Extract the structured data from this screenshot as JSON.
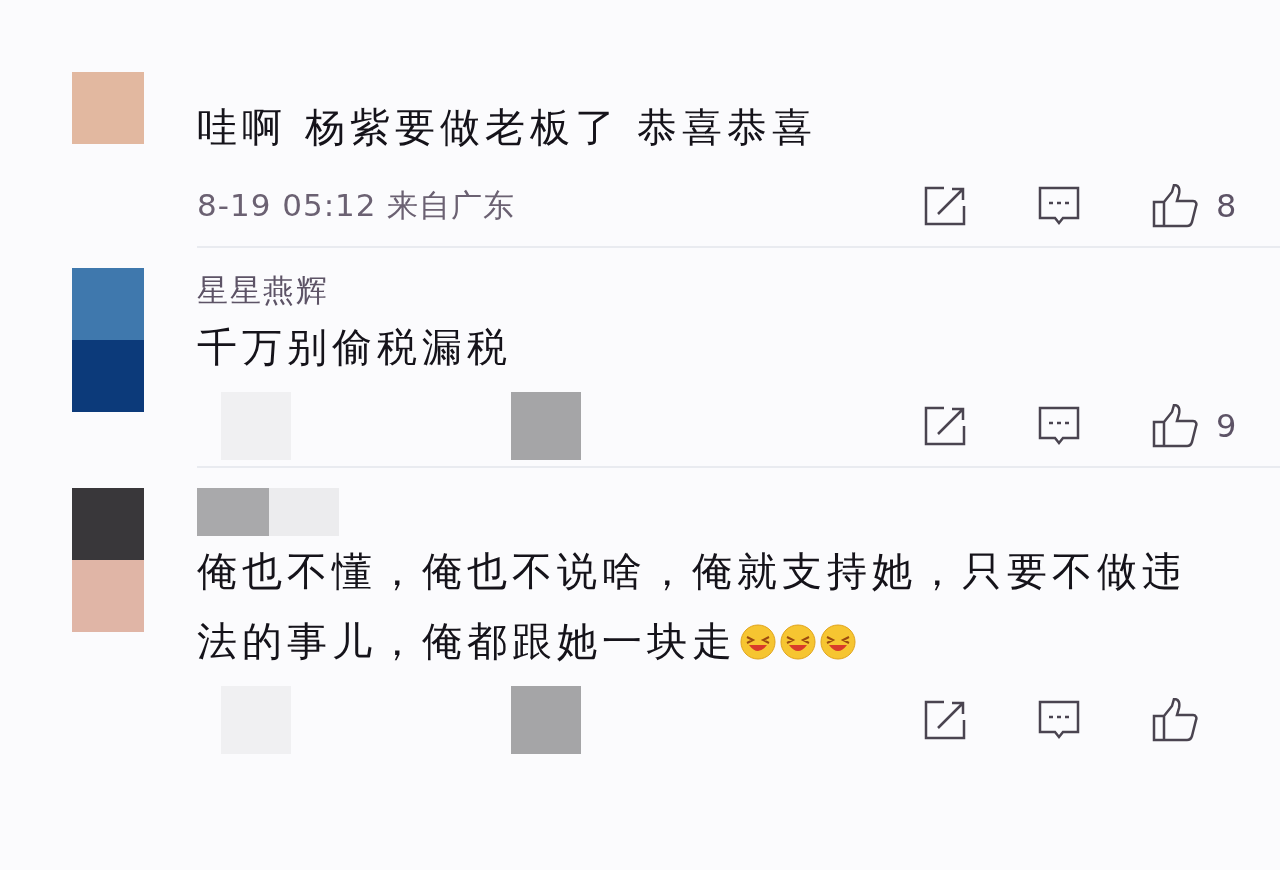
{
  "comments": [
    {
      "text": "哇啊 杨紫要做老板了 恭喜恭喜",
      "meta": "8-19 05:12 来自广东",
      "likes": "8"
    },
    {
      "name": "星星燕辉",
      "name_hidden": false,
      "text": "千万别偷税漏税",
      "redacted_extras": true,
      "likes": "9"
    },
    {
      "name_hidden": true,
      "text": "俺也不懂，俺也不说啥，俺就支持她，只要不做违法的事儿，俺都跟她一块走",
      "emojis": [
        {
          "kind": "laughing"
        },
        {
          "kind": "laughing"
        },
        {
          "kind": "laughing"
        }
      ],
      "redacted_extras": true
    }
  ]
}
